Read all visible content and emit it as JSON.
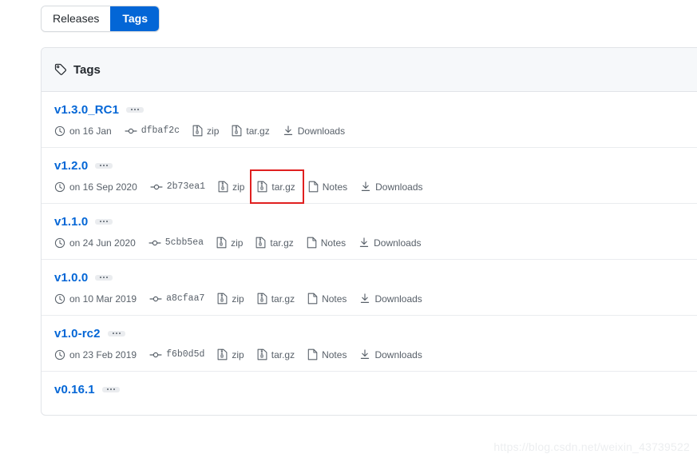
{
  "tabs": [
    {
      "label": "Releases",
      "active": false
    },
    {
      "label": "Tags",
      "active": true
    }
  ],
  "panel": {
    "header_title": "Tags",
    "header_icon": "tag-icon"
  },
  "labels": {
    "zip": "zip",
    "targz": "tar.gz",
    "notes": "Notes",
    "downloads": "Downloads"
  },
  "colors": {
    "accent": "#0366d6",
    "link": "#0366d6",
    "muted": "#586069",
    "header_bg": "#f6f8fa",
    "border": "#e1e4e8",
    "highlight": "#e02020"
  },
  "tags": [
    {
      "name": "v1.3.0_RC1",
      "date": "on 16 Jan",
      "commit": "dfbaf2c",
      "zip": "zip",
      "targz": "tar.gz",
      "notes": null,
      "downloads": "Downloads",
      "highlight_targz": false
    },
    {
      "name": "v1.2.0",
      "date": "on 16 Sep 2020",
      "commit": "2b73ea1",
      "zip": "zip",
      "targz": "tar.gz",
      "notes": "Notes",
      "downloads": "Downloads",
      "highlight_targz": true
    },
    {
      "name": "v1.1.0",
      "date": "on 24 Jun 2020",
      "commit": "5cbb5ea",
      "zip": "zip",
      "targz": "tar.gz",
      "notes": "Notes",
      "downloads": "Downloads",
      "highlight_targz": false
    },
    {
      "name": "v1.0.0",
      "date": "on 10 Mar 2019",
      "commit": "a8cfaa7",
      "zip": "zip",
      "targz": "tar.gz",
      "notes": "Notes",
      "downloads": "Downloads",
      "highlight_targz": false
    },
    {
      "name": "v1.0-rc2",
      "date": "on 23 Feb 2019",
      "commit": "f6b0d5d",
      "zip": "zip",
      "targz": "tar.gz",
      "notes": "Notes",
      "downloads": "Downloads",
      "highlight_targz": false
    },
    {
      "name": "v0.16.1",
      "date": null,
      "commit": null,
      "zip": null,
      "targz": null,
      "notes": null,
      "downloads": null,
      "highlight_targz": false
    }
  ],
  "watermark": "https://blog.csdn.net/weixin_43739522"
}
